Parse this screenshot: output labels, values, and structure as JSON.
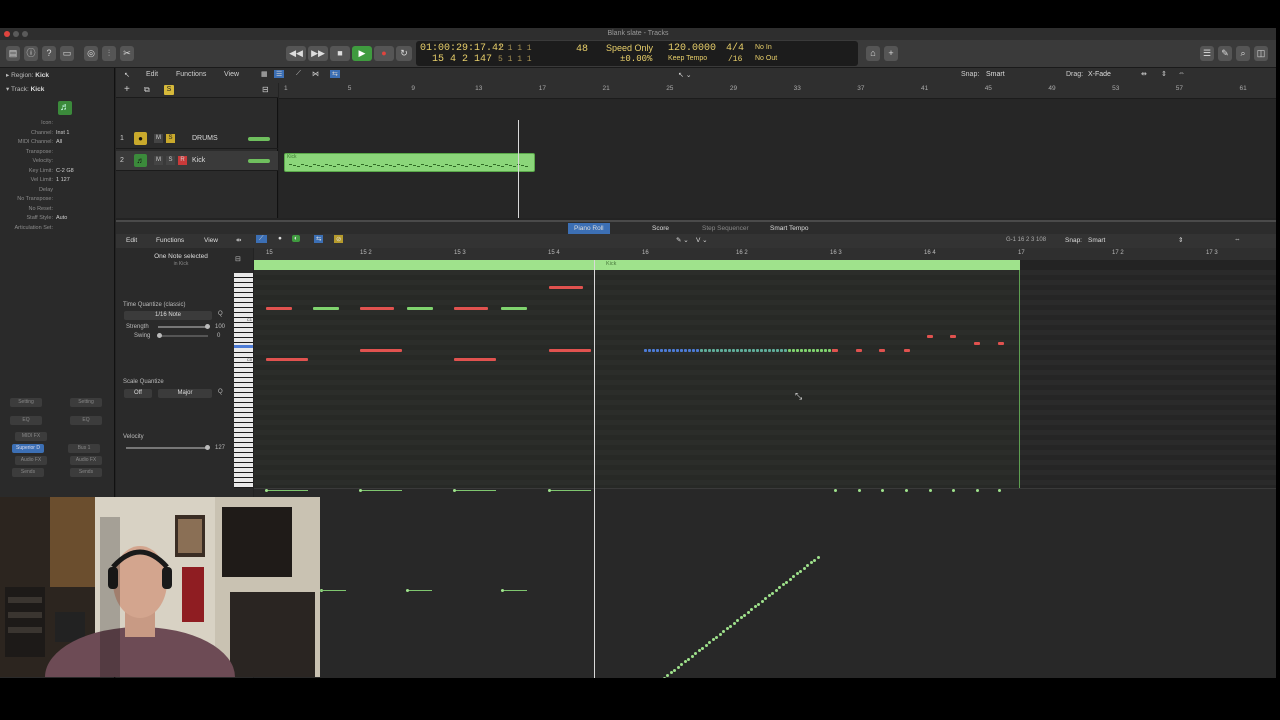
{
  "window": {
    "title": "Blank slate - Tracks"
  },
  "lcd": {
    "time": "01:00:29:17.42",
    "bars": "15  4  2  147",
    "cycle1": "1  1  1    1",
    "cycle2": "5  1  1    1",
    "position_small": "48",
    "mode": "Speed Only",
    "speed": "±0.00%",
    "tempo": "120.0000",
    "tempo_mode": "Keep Tempo",
    "signature": "4/4",
    "division": "/16",
    "midi_in": "No In",
    "midi_out": "No Out"
  },
  "inspector": {
    "region_label": "Region:",
    "region_name": "Kick",
    "track_label": "Track:",
    "track_name": "Kick",
    "fields": [
      {
        "k": "Icon:",
        "v": ""
      },
      {
        "k": "Channel:",
        "v": "Inst 1"
      },
      {
        "k": "MIDI Channel:",
        "v": "All"
      },
      {
        "k": "Transpose:",
        "v": ""
      },
      {
        "k": "Velocity:",
        "v": ""
      },
      {
        "k": "Key Limit:",
        "v": "C-2  G8"
      },
      {
        "k": "Vel Limit:",
        "v": "1  127"
      },
      {
        "k": "Delay",
        "v": ""
      },
      {
        "k": "No Transpose:",
        "v": ""
      },
      {
        "k": "No Reset:",
        "v": ""
      },
      {
        "k": "Staff Style:",
        "v": "Auto"
      },
      {
        "k": "Articulation Set:",
        "v": ""
      }
    ],
    "buttons": [
      "Setting",
      "Setting",
      "EQ",
      "EQ",
      "MIDI FX",
      "Superior D",
      "Bus 1",
      "Audio FX",
      "Audio FX",
      "Sends",
      "Sends"
    ]
  },
  "tracks_menu": {
    "edit": "Edit",
    "functions": "Functions",
    "view": "View",
    "snap_label": "Snap:",
    "snap_value": "Smart",
    "drag_label": "Drag:",
    "drag_value": "X-Fade"
  },
  "tracks": [
    {
      "num": "1",
      "name": "DRUMS"
    },
    {
      "num": "2",
      "name": "Kick"
    }
  ],
  "ruler_bars": [
    "1",
    "5",
    "9",
    "13",
    "17",
    "21",
    "25",
    "29",
    "33",
    "37",
    "41",
    "45",
    "49",
    "53",
    "57",
    "61"
  ],
  "region_name": "Kick",
  "editor_tabs": [
    "Piano Roll",
    "Score",
    "Step Sequencer",
    "Smart Tempo"
  ],
  "editor_menu": {
    "edit": "Edit",
    "functions": "Functions",
    "view": "View",
    "position": "G-1  16 2 3 108",
    "snap_label": "Snap:",
    "snap_value": "Smart"
  },
  "editor_left": {
    "selection": "One Note selected",
    "selection_sub": "in Kick",
    "tq_label": "Time Quantize (classic)",
    "tq_value": "1/16 Note",
    "q": "Q",
    "strength_label": "Strength",
    "strength_value": "100",
    "swing_label": "Swing",
    "swing_value": "0",
    "sq_label": "Scale Quantize",
    "sq_off": "Off",
    "sq_scale": "Major",
    "velocity_label": "Velocity",
    "velocity_value": "127"
  },
  "pr_ruler": [
    "15",
    "15 2",
    "15 3",
    "15 4",
    "16",
    "16 2",
    "16 3",
    "16 4",
    "17",
    "17 2",
    "17 3"
  ],
  "pr_region_label": "Kick",
  "key_labels": [
    "C1",
    "C0"
  ],
  "colors": {
    "region": "#8bd67a",
    "note_red": "#e0524f",
    "note_green": "#7fd36e",
    "note_blue": "#4c7bd6",
    "playhead": "#d9d9d9"
  }
}
